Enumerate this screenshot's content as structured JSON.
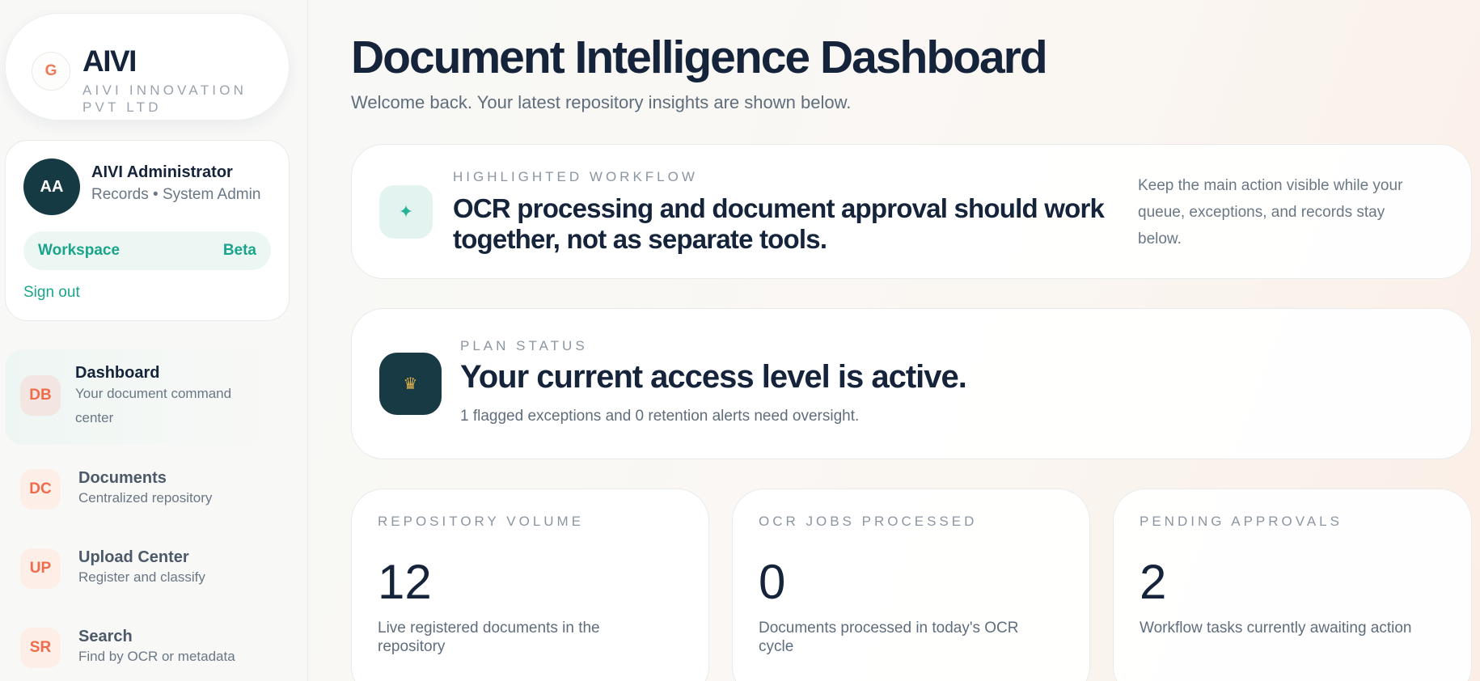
{
  "brand": {
    "logo_letter": "G",
    "name": "AIVI",
    "subtitle": "AIVI INNOVATION PVT LTD"
  },
  "user": {
    "initials": "AA",
    "name": "AIVI Administrator",
    "role": "Records • System Admin",
    "workspace_label": "Workspace",
    "workspace_badge": "Beta",
    "signout_label": "Sign out"
  },
  "nav": {
    "items": [
      {
        "badge": "DB",
        "title": "Dashboard",
        "desc": "Your document command center",
        "active": true
      },
      {
        "badge": "DC",
        "title": "Documents",
        "desc": "Centralized repository",
        "active": false
      },
      {
        "badge": "UP",
        "title": "Upload Center",
        "desc": "Register and classify",
        "active": false
      },
      {
        "badge": "SR",
        "title": "Search",
        "desc": "Find by OCR or metadata",
        "active": false
      }
    ]
  },
  "header": {
    "title": "Document Intelligence Dashboard",
    "subtitle": "Welcome back. Your latest repository insights are shown below."
  },
  "workflow": {
    "icon": "sparkle-icon",
    "eyebrow": "HIGHLIGHTED WORKFLOW",
    "headline": "OCR processing and document approval should work together, not as separate tools.",
    "side_note": "Keep the main action visible while your queue, exceptions, and records stay below."
  },
  "plan": {
    "icon": "crown-icon",
    "eyebrow": "PLAN STATUS",
    "headline": "Your current access level is active.",
    "note": "1 flagged exceptions and 0 retention alerts need oversight."
  },
  "stats": [
    {
      "label": "REPOSITORY VOLUME",
      "value": "12",
      "desc": "Live registered documents in the repository"
    },
    {
      "label": "OCR JOBS PROCESSED",
      "value": "0",
      "desc": "Documents processed in today's OCR cycle"
    },
    {
      "label": "PENDING APPROVALS",
      "value": "2",
      "desc": "Workflow tasks currently awaiting action"
    }
  ],
  "colors": {
    "accent": "#1aa58b",
    "navy": "#15243a",
    "badge_orange": "#ef6c4a"
  }
}
